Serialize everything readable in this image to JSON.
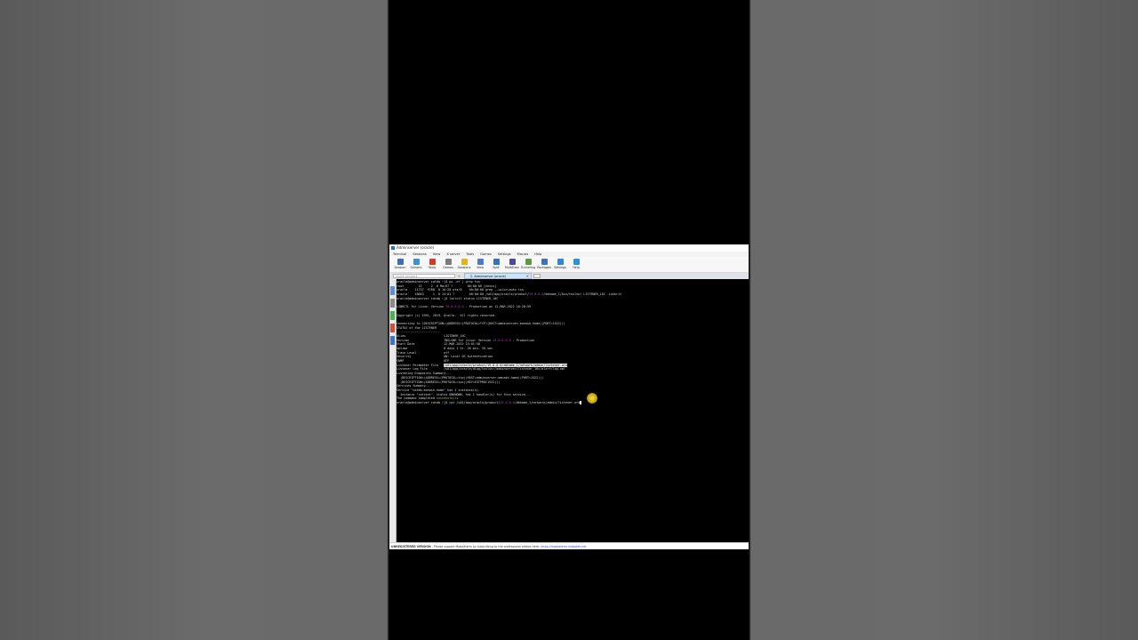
{
  "window": {
    "title": "Adminserver (oracle)"
  },
  "menu": [
    "Terminal",
    "Sessions",
    "View",
    "X server",
    "Tools",
    "Games",
    "Settings",
    "Macros",
    "Help"
  ],
  "toolbar": [
    {
      "label": "Session",
      "icon": "session-icon",
      "color": "#3b6fb6"
    },
    {
      "label": "Servers",
      "icon": "servers-icon",
      "color": "#3d8fd8"
    },
    {
      "label": "Tools",
      "icon": "tools-icon",
      "color": "#d23b2b"
    },
    {
      "label": "Games",
      "icon": "games-icon",
      "color": "#7a7a7a"
    },
    {
      "label": "Sessions",
      "icon": "star-icon",
      "color": "#e4b416"
    },
    {
      "label": "View",
      "icon": "view-icon",
      "color": "#4a79c8"
    },
    {
      "label": "Split",
      "icon": "split-icon",
      "color": "#3470c4"
    },
    {
      "label": "MultiExec",
      "icon": "multiexec-icon",
      "color": "#4b4b8f"
    },
    {
      "label": "Tunneling",
      "icon": "tunneling-icon",
      "color": "#5c9b3c"
    },
    {
      "label": "Packages",
      "icon": "packages-icon",
      "color": "#3a73c2"
    },
    {
      "label": "Settings",
      "icon": "settings-icon",
      "color": "#2f86d6"
    },
    {
      "label": "Help",
      "icon": "help-icon",
      "color": "#2a8ee6"
    }
  ],
  "tabs": {
    "quick_connect_placeholder": "Quick connect...",
    "active_tab": "2. Adminserver (oracle)"
  },
  "terminal": {
    "lines": [
      [
        {
          "t": "oracle@adminserver catdb ~]$ ps -ef | grep tns"
        }
      ],
      [
        {
          "t": "root        22     2  0 Mar07 ?        00:00:00 [netns]"
        }
      ],
      [
        {
          "t": "oracle    11737  9708  0 16:28 pts/0    00:00:00 grep --color=auto tns"
        }
      ],
      [
        {
          "t": "oracle    18663     1  0 15:01 ?        00:00:00 /u01/app/oracle/product/"
        },
        {
          "t": "19.0.0.0",
          "c": "hl"
        },
        {
          "t": "/dbhome_1/bin/tnslsnr LISTENER_10C -inherit"
        }
      ],
      [
        {
          "t": "oracle@adminserver catdb ~]$ lsnrctl status LISTENER_10C"
        }
      ],
      [
        {
          "t": ""
        }
      ],
      [
        {
          "t": "LSNRCTL for Linux: Version "
        },
        {
          "t": "19.0.0.0.0",
          "c": "hl"
        },
        {
          "t": " - Production on 12-MAR-2022 16:28:59"
        }
      ],
      [
        {
          "t": ""
        }
      ],
      [
        {
          "t": "Copyright (c) 1991, 2019, Oracle.  All rights reserved."
        }
      ],
      [
        {
          "t": ""
        }
      ],
      [
        {
          "t": "Connecting to (DESCRIPTION=(ADDRESS=(PROTOCOL=TCP)(HOST=adminserver.manash.home)(PORT=1522)))"
        }
      ],
      [
        {
          "t": "STATUS of the LISTENER"
        }
      ],
      [
        {
          "t": "------------------------"
        }
      ],
      [
        {
          "t": "Alias                     LISTENER_10C"
        }
      ],
      [
        {
          "t": "Version                   TNSLSNR for Linux: Version "
        },
        {
          "t": "19.0.0.0.0",
          "c": "hl"
        },
        {
          "t": " - Production"
        }
      ],
      [
        {
          "t": "Start Date                12-MAR-2022 15:01:58"
        }
      ],
      [
        {
          "t": "Uptime                    0 days 1 hr. 26 min. 55 sec"
        }
      ],
      [
        {
          "t": "Trace Level               off"
        }
      ],
      [
        {
          "t": "Security                  ON: Local OS Authentication"
        }
      ],
      [
        {
          "t": "SNMP                      OFF"
        }
      ],
      [
        {
          "t": "Listener Parameter File   "
        },
        {
          "t": "/u01/app/oracle/product/19.0.0.0/dbhome_1/network/admin/listener.ora",
          "c": "sel"
        }
      ],
      [
        {
          "t": "Listener Log File         /u01/app/oracle/diag/tnslsnr/adminserver/listener_10c/alert/log.xml"
        }
      ],
      [
        {
          "t": "Listening Endpoints Summary..."
        }
      ],
      [
        {
          "t": "  (DESCRIPTION=(ADDRESS=(PROTOCOL=tcp)(HOST=adminserver.manash.home)(PORT=1522)))"
        }
      ],
      [
        {
          "t": "  (DESCRIPTION=(ADDRESS=(PROTOCOL=ipc)(KEY=EXTPROC1522)))"
        }
      ],
      [
        {
          "t": "Services Summary..."
        }
      ],
      [
        {
          "t": "Service \"catdb.manash.home\" has 1 instance(s)."
        }
      ],
      [
        {
          "t": "  Instance \"catcont\", status UNKNOWN, has 1 handler(s) for this service..."
        }
      ],
      [
        {
          "t": "The command completed "
        },
        {
          "t": "successfully",
          "c": "ok"
        }
      ],
      [
        {
          "t": "oracle@adminserver catdb ~]$ cat /u01/app/oracle/product/"
        },
        {
          "t": "19.0.0.0",
          "c": "hl"
        },
        {
          "t": "/dbhome_1/network/admin/listener.ora"
        }
      ]
    ]
  },
  "statusbar": {
    "left": "UNREGISTERED VERSION",
    "middle": " - Please support MobaXterm by subscribing to the professional edition here: ",
    "link": "https://mobaxterm.mobatek.net"
  }
}
